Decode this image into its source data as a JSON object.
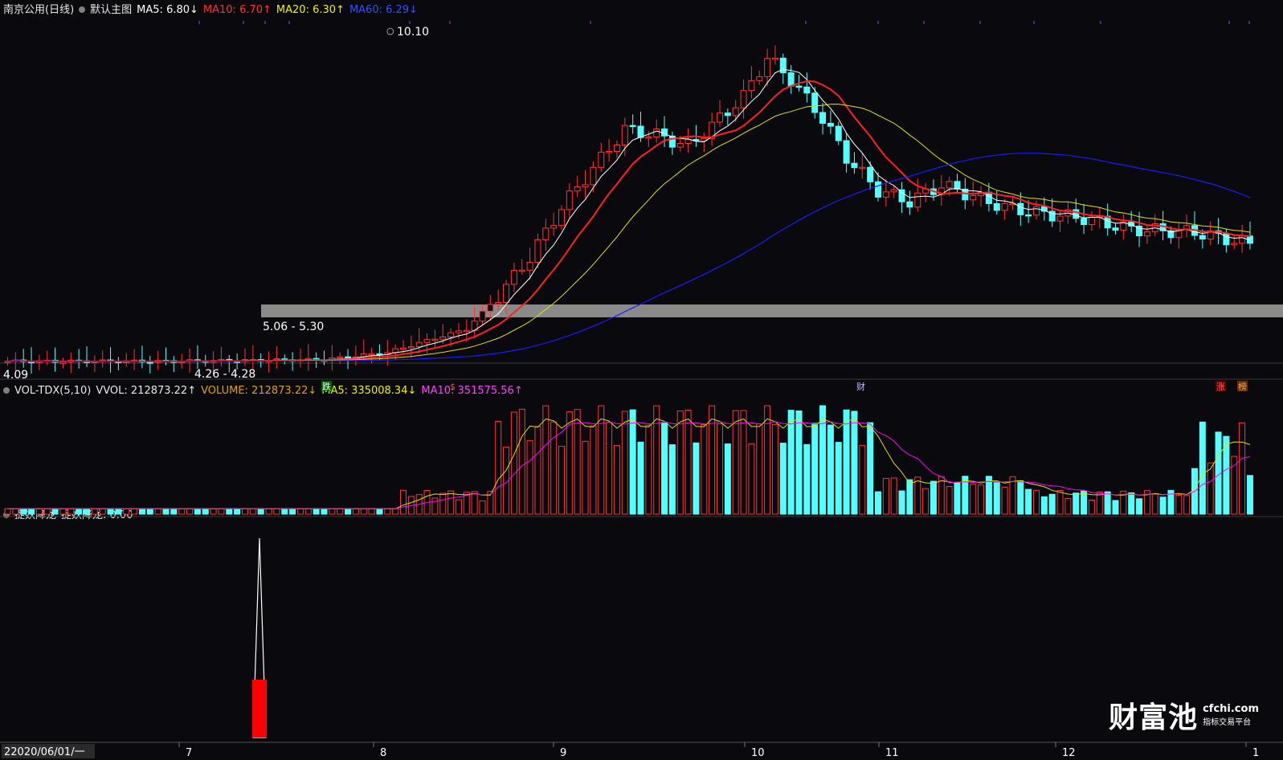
{
  "kline_header": {
    "title": "南京公用(日线)",
    "template": "默认主图",
    "ma5": "MA5: 6.80↓",
    "ma10": "MA10: 6.70↑",
    "ma20": "MA20: 6.30↑",
    "ma60": "MA60: 6.29↓"
  },
  "vol_header": {
    "name": "VOL-TDX(5,10)",
    "vvol": "VVOL: 212873.22↑",
    "volume": "VOLUME: 212873.22↓",
    "ma5": "MA5: 335008.34↓",
    "ma10": "MA10: 351575.56↑"
  },
  "ind_header": {
    "name": "捉妖降龙",
    "value": "捉妖降龙: 0.00"
  },
  "annotations": {
    "high": "10.10",
    "low": "4.09",
    "range1": "4.26 - 4.28",
    "range2": "5.06 - 5.30"
  },
  "markers": {
    "die": "跌",
    "s": "$",
    "cai": "财",
    "zhang": "涨",
    "bang": "榜"
  },
  "x_axis": {
    "start": "22020/06/01/一",
    "months": [
      "7",
      "8",
      "9",
      "10",
      "11",
      "12",
      "1"
    ]
  },
  "watermark": {
    "main": "财富池",
    "url": "cfchi.com",
    "tag": "指标交易平台"
  },
  "colors": {
    "up": "#ff3232",
    "down": "#54ffff",
    "ma5": "#ffffff",
    "ma10": "#ff2020",
    "ma20": "#e0e000",
    "ma60": "#1a1aff",
    "vol_ma10": "#ff00ff",
    "band": "#8a8a8a"
  },
  "chart_data": {
    "type": "candlestick",
    "price_range": [
      4.0,
      10.2
    ],
    "ohlc_bar_count": 158,
    "key_prices": {
      "high": 10.1,
      "low": 4.09
    }
  }
}
